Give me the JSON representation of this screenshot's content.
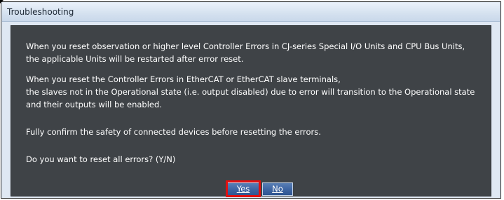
{
  "window": {
    "title": "Troubleshooting"
  },
  "message": {
    "lines": [
      "When you reset observation or higher level Controller Errors in CJ-series Special I/O Units and CPU Bus Units,",
      "the applicable Units will be restarted after error reset.",
      "When you reset the Controller Errors in EtherCAT or EtherCAT slave terminals,",
      "the slaves not in the Operational state (i.e. output disabled) due to error will transition to the Operational state",
      "and their outputs will be enabled.",
      "Fully confirm the safety of connected devices before resetting the errors.",
      "Do you want to reset all errors? (Y/N)"
    ]
  },
  "buttons": {
    "yes_label": "Yes",
    "no_label": "No"
  },
  "colors": {
    "panel_background": "#3f4347",
    "button": "#3f66a3",
    "highlight": "#e11010",
    "titlebar": "#d6e2f0"
  }
}
